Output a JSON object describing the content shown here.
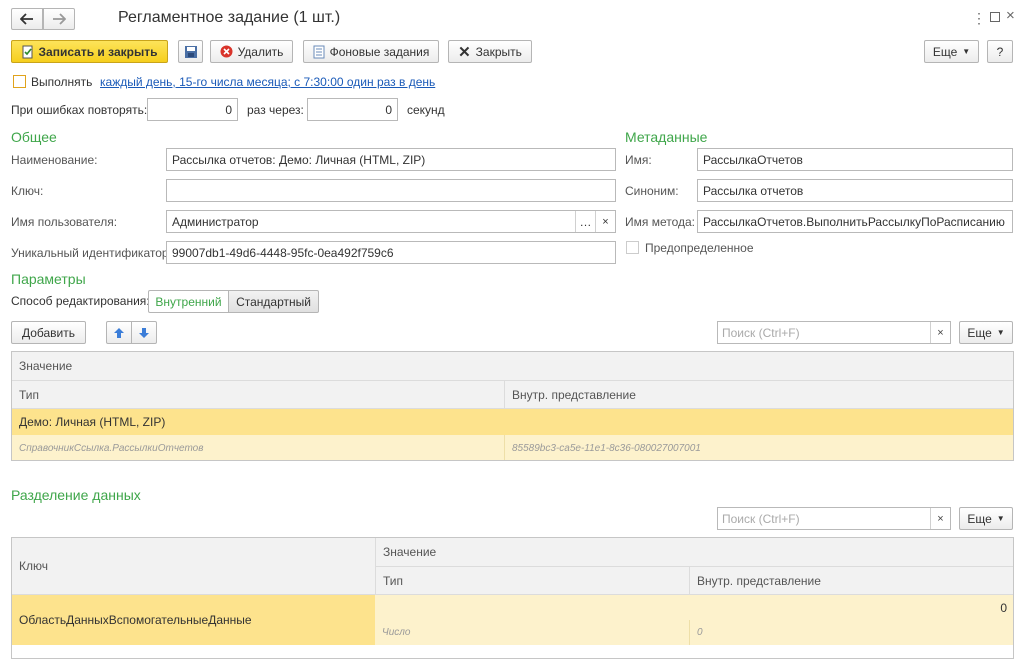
{
  "window": {
    "title": "Регламентное задание (1 шт.)",
    "back_icon": "arrow-left",
    "forward_icon": "arrow-right"
  },
  "toolbar": {
    "save_close": "Записать и закрыть",
    "delete": "Удалить",
    "background_jobs": "Фоновые задания",
    "close": "Закрыть",
    "more": "Еще",
    "help": "?"
  },
  "schedule": {
    "run_label": "Выполнять",
    "link": "каждый день, 15-го числа месяца; с 7:30:00 один раз в день",
    "retry_label": "При ошибках повторять:",
    "retry_count": "0",
    "times_through": "раз через:",
    "retry_interval": "0",
    "seconds": "секунд"
  },
  "general": {
    "title": "Общее",
    "name_label": "Наименование:",
    "name_value": "Рассылка отчетов: Демо: Личная (HTML, ZIP)",
    "key_label": "Ключ:",
    "key_value": "",
    "user_label": "Имя пользователя:",
    "user_value": "Администратор",
    "uid_label": "Уникальный идентификатор:",
    "uid_value": "99007db1-49d6-4448-95fc-0ea492f759c6"
  },
  "metadata": {
    "title": "Метаданные",
    "name_label": "Имя:",
    "name_value": "РассылкаОтчетов",
    "synonym_label": "Синоним:",
    "synonym_value": "Рассылка отчетов",
    "method_label": "Имя метода:",
    "method_value": "РассылкаОтчетов.ВыполнитьРассылкуПоРасписанию",
    "predefined_label": "Предопределенное"
  },
  "params": {
    "title": "Параметры",
    "edit_mode_label": "Способ редактирования:",
    "mode_internal": "Внутренний",
    "mode_standard": "Стандартный",
    "add_button": "Добавить",
    "search_placeholder": "Поиск (Ctrl+F)",
    "more": "Еще",
    "col_value": "Значение",
    "col_type": "Тип",
    "col_internal": "Внутр. представление",
    "row_value": "Демо: Личная (HTML, ZIP)",
    "row_type": "СправочникСсылка.РассылкиОтчетов",
    "row_internal": "85589bc3-ca5e-11e1-8c36-080027007001"
  },
  "separation": {
    "title": "Разделение данных",
    "search_placeholder": "Поиск (Ctrl+F)",
    "more": "Еще",
    "col_key": "Ключ",
    "col_value": "Значение",
    "col_type": "Тип",
    "col_internal": "Внутр. представление",
    "row_key": "ОбластьДанныхВспомогательныеДанные",
    "row_value": "0",
    "row_type": "Число",
    "row_internal": "0"
  },
  "colors": {
    "accent_green": "#3fa64a",
    "selected_row": "#fde38d",
    "selected_row_light": "#fdf2cc",
    "primary_button": "#f6cf1d",
    "link": "#1a5ab8"
  }
}
